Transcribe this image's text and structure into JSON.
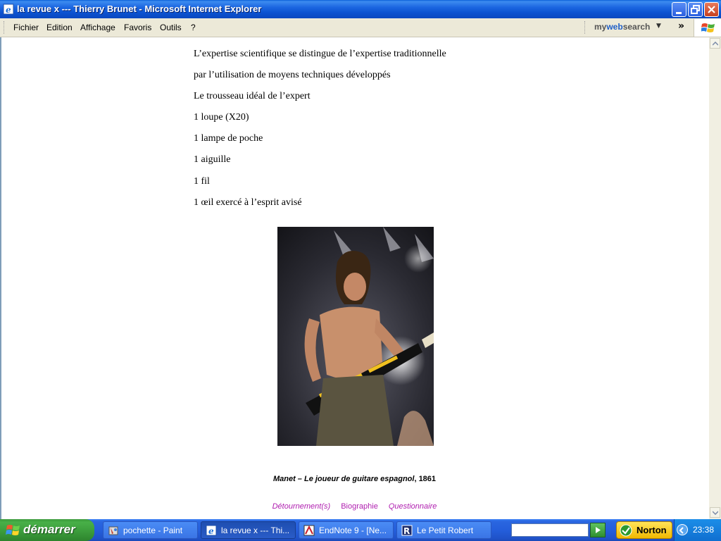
{
  "window": {
    "title": "la revue x --- Thierry Brunet - Microsoft Internet Explorer"
  },
  "menu": {
    "items": [
      "Fichier",
      "Edition",
      "Affichage",
      "Favoris",
      "Outils",
      "?"
    ],
    "toolbar": {
      "mywebsearch_a": "my",
      "mywebsearch_b": "web",
      "mywebsearch_c": "search",
      "chevron": "»"
    }
  },
  "content": {
    "lines": [
      "L’expertise scientifique se distingue de l’expertise traditionnelle",
      "par l’utilisation de moyens techniques développés",
      "Le trousseau idéal de l’expert",
      "1 loupe (X20)",
      "1 lampe de poche",
      "1 aiguille",
      "1 fil",
      "1 œil exercé à l’esprit avisé"
    ],
    "caption": {
      "author": "Manet – ",
      "title": "Le joueur de guitare espagnol",
      "year": ", 1861"
    },
    "links": [
      "Détournement(s)",
      "Biographie",
      "Questionnaire"
    ]
  },
  "taskbar": {
    "start": "démarrer",
    "tasks": [
      {
        "label": "pochette - Paint",
        "icon": "paint-icon"
      },
      {
        "label": "la revue x --- Thi...",
        "icon": "ie-icon"
      },
      {
        "label": "EndNote 9 - [Ne...",
        "icon": "endnote-icon"
      },
      {
        "label": "Le Petit Robert",
        "icon": "petit-robert-icon"
      }
    ],
    "norton": "Norton",
    "clock": "23:38"
  }
}
